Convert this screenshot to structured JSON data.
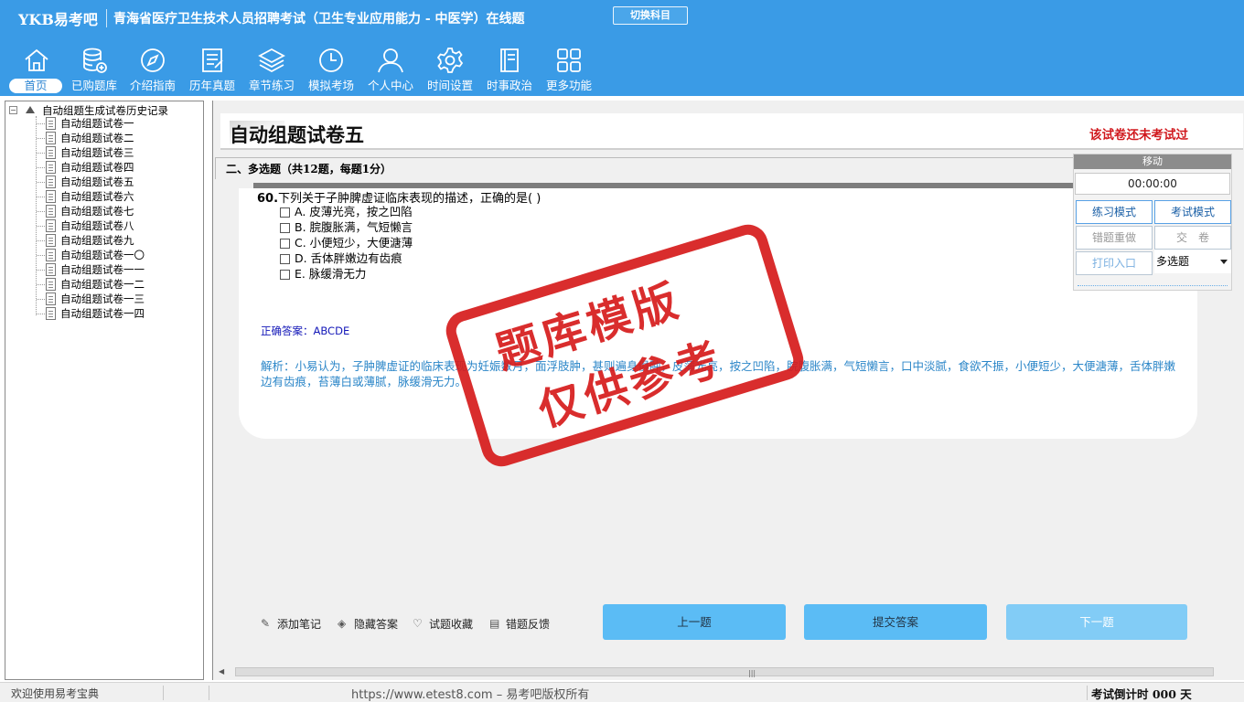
{
  "header": {
    "brand": "YKB易考吧",
    "exam_title": "青海省医疗卫生技术人员招聘考试（卫生专业应用能力 - 中医学）在线题",
    "switch_subject": "切换科目"
  },
  "nav": {
    "items": [
      {
        "label": "首页",
        "icon": "home-icon"
      },
      {
        "label": "已购题库",
        "icon": "database-icon"
      },
      {
        "label": "介绍指南",
        "icon": "compass-icon"
      },
      {
        "label": "历年真题",
        "icon": "document-list-icon"
      },
      {
        "label": "章节练习",
        "icon": "layers-icon"
      },
      {
        "label": "模拟考场",
        "icon": "clock-icon"
      },
      {
        "label": "个人中心",
        "icon": "user-icon"
      },
      {
        "label": "时间设置",
        "icon": "gear-icon"
      },
      {
        "label": "时事政治",
        "icon": "notebook-icon"
      },
      {
        "label": "更多功能",
        "icon": "grid-icon"
      }
    ]
  },
  "tree": {
    "root": "自动组题生成试卷历史记录",
    "items": [
      "自动组题试卷一",
      "自动组题试卷二",
      "自动组题试卷三",
      "自动组题试卷四",
      "自动组题试卷五",
      "自动组题试卷六",
      "自动组题试卷七",
      "自动组题试卷八",
      "自动组题试卷九",
      "自动组题试卷一〇",
      "自动组题试卷一一",
      "自动组题试卷一二",
      "自动组题试卷一三",
      "自动组题试卷一四"
    ]
  },
  "paper": {
    "title": "自动组题试卷五",
    "status": "该试卷还未考试过",
    "section": "二、多选题（共12题，每题1分）"
  },
  "question": {
    "number": "60.",
    "stem": "下列关于子肿脾虚证临床表现的描述，正确的是( )",
    "options": [
      "A. 皮薄光亮，按之凹陷",
      "B. 脘腹胀满，气短懒言",
      "C. 小便短少，大便溏薄",
      "D. 舌体胖嫩边有齿痕",
      "E. 脉缓滑无力"
    ],
    "answer_label": "正确答案：",
    "answer_value": "ABCDE",
    "analysis": "解析：小易认为，子肿脾虚证的临床表现为妊娠数月，面浮肢肿，甚则遍身俱肿，皮薄光亮，按之凹陷，脘腹胀满，气短懒言，口中淡腻，食欲不振，小便短少，大便溏薄，舌体胖嫩边有齿痕，苔薄白或薄腻，脉缓滑无力。"
  },
  "timer": {
    "header": "移动",
    "value": "00:00:00",
    "practice_mode": "练习模式",
    "exam_mode": "考试模式",
    "redo_wrong": "错题重做",
    "submit_paper": "交　卷",
    "print": "打印入口",
    "type_select": "多选题"
  },
  "tools": {
    "add_note": "添加笔记",
    "hide_answer": "隐藏答案",
    "favorite": "试题收藏",
    "feedback": "错题反馈"
  },
  "buttons": {
    "prev": "上一题",
    "submit": "提交答案",
    "next": "下一题"
  },
  "stamp": {
    "line1": "题库模版",
    "line2": "仅供参考"
  },
  "status": {
    "welcome": "欢迎使用易考宝典",
    "copyright": "https://www.etest8.com – 易考吧版权所有",
    "countdown": "考试倒计时 000 天"
  },
  "colors": {
    "header_bg": "#3a9be6",
    "accent_red": "#d0181d",
    "answer_blue": "#1418b8",
    "analysis_blue": "#2b86c8",
    "button_blue": "#5bbcf5"
  }
}
